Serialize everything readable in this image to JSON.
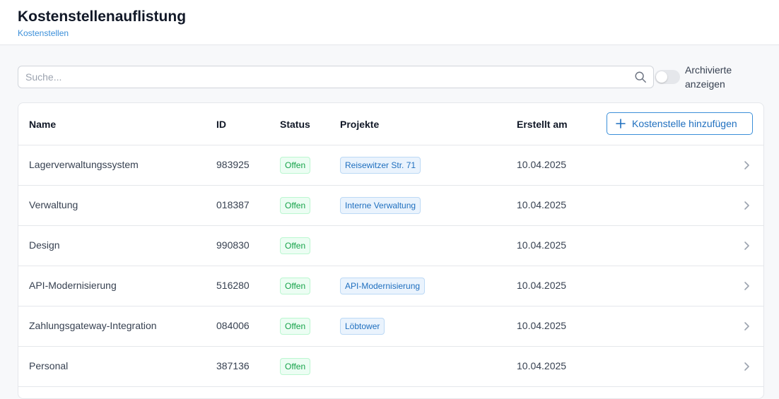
{
  "header": {
    "title": "Kostenstellenauflistung",
    "breadcrumb": "Kostenstellen"
  },
  "search": {
    "placeholder": "Suche...",
    "value": ""
  },
  "archive_toggle": {
    "label": "Archivierte anzeigen",
    "checked": false
  },
  "table": {
    "columns": [
      "Name",
      "ID",
      "Status",
      "Projekte",
      "Erstellt am"
    ],
    "add_button": "Kostenstelle hinzufügen",
    "rows": [
      {
        "name": "Lagerverwaltungssystem",
        "id": "983925",
        "status": "Offen",
        "project": "Reisewitzer Str. 71",
        "created": "10.04.2025"
      },
      {
        "name": "Verwaltung",
        "id": "018387",
        "status": "Offen",
        "project": "Interne Verwaltung",
        "created": "10.04.2025"
      },
      {
        "name": "Design",
        "id": "990830",
        "status": "Offen",
        "project": "",
        "created": "10.04.2025"
      },
      {
        "name": "API-Modernisierung",
        "id": "516280",
        "status": "Offen",
        "project": "API-Modernisierung",
        "created": "10.04.2025"
      },
      {
        "name": "Zahlungsgateway-Integration",
        "id": "084006",
        "status": "Offen",
        "project": "Löbtower",
        "created": "10.04.2025"
      },
      {
        "name": "Personal",
        "id": "387136",
        "status": "Offen",
        "project": "",
        "created": "10.04.2025"
      }
    ]
  },
  "colors": {
    "accent": "#3b8fd9",
    "status_open": "#16a34a"
  }
}
